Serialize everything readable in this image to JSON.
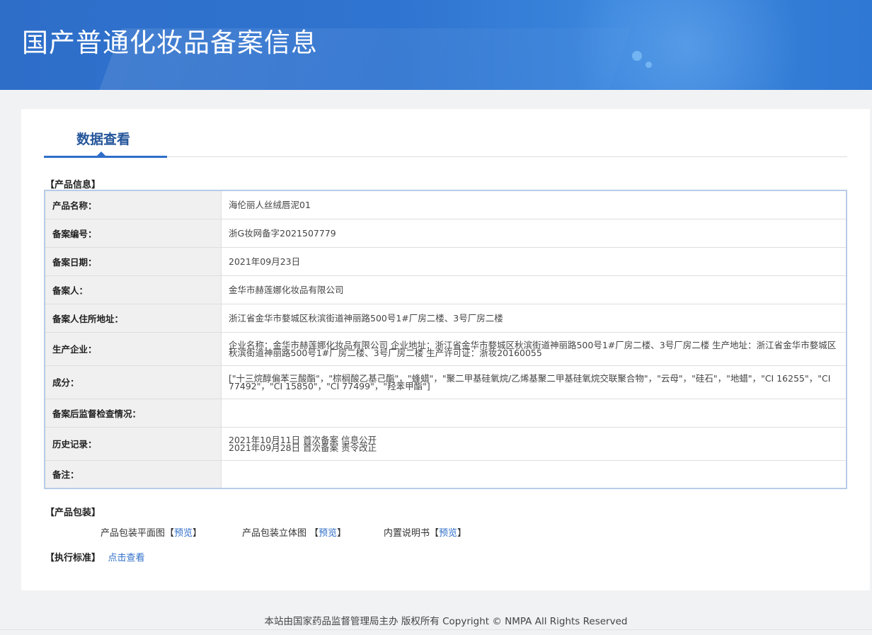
{
  "header": {
    "title": "国产普通化妆品备案信息"
  },
  "tab": {
    "label": "数据查看"
  },
  "product_section": {
    "title": "【产品信息】"
  },
  "rows": [
    {
      "label": "产品名称：",
      "value": "海伦丽人丝绒唇泥01"
    },
    {
      "label": "备案编号：",
      "value": "浙G妆网备字2021507779"
    },
    {
      "label": "备案日期：",
      "value": "2021年09月23日"
    },
    {
      "label": "备案人：",
      "value": "金华市赫莲娜化妆品有限公司"
    },
    {
      "label": "备案人住所地址：",
      "value": "浙江省金华市婺城区秋滨街道神丽路500号1#厂房二楼、3号厂房二楼"
    },
    {
      "label": "生产企业：",
      "value": "企业名称：金华市赫莲娜化妆品有限公司 企业地址：浙江省金华市婺城区秋滨街道神丽路500号1#厂房二楼、3号厂房二楼 生产地址：浙江省金华市婺城区秋滨街道神丽路500号1#厂房二楼、3号厂房二楼 生产许可证：浙妆20160055"
    },
    {
      "label": "成分：",
      "value": "[\"十三烷醇偏苯三酸酯\"，\"棕榈酸乙基己酯\"，\"蜂蜡\"，\"聚二甲基硅氧烷/乙烯基聚二甲基硅氧烷交联聚合物\"，\"云母\"，\"硅石\"，\"地蜡\"，\"CI 16255\"，\"CI 77492\"，\"CI 15850\"，\"CI 77499\"，\"羟苯甲酯\"]"
    },
    {
      "label": "备案后监督检查情况：",
      "value": ""
    },
    {
      "label": "历史记录：",
      "value": "",
      "lines": [
        "2021年10月11日 首次备案 信息公开",
        "2021年09月28日 首次备案 责令改正"
      ]
    },
    {
      "label": "备注：",
      "value": ""
    }
  ],
  "packaging": {
    "title": "【产品包装】",
    "items": [
      {
        "label": "产品包装平面图",
        "link": "预览"
      },
      {
        "label": "产品包装立体图 ",
        "link": "预览"
      },
      {
        "label": "内置说明书",
        "link": "预览"
      }
    ]
  },
  "standard": {
    "title": "【执行标准】",
    "link": "点击查看"
  },
  "footer": {
    "text": "本站由国家药品监督管理局主办 版权所有 Copyright © NMPA All Rights Reserved"
  }
}
